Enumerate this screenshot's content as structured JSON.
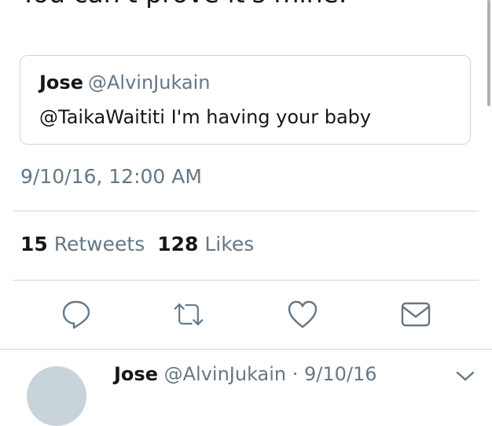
{
  "tweet": {
    "text_partial": "You can't prove it's mine.",
    "timestamp": "9/10/16, 12:00 AM"
  },
  "quoted_tweet": {
    "name": "Jose",
    "handle": "@AlvinJukain",
    "text": "@TaikaWaititi I'm having your baby"
  },
  "stats": {
    "retweets_count": "15",
    "retweets_label": "Retweets",
    "likes_count": "128",
    "likes_label": "Likes"
  },
  "actions": {
    "reply_icon": "reply-icon",
    "retweet_icon": "retweet-icon",
    "like_icon": "heart-icon",
    "share_icon": "mail-icon"
  },
  "reply_preview": {
    "name": "Jose",
    "handle_and_date": "@AlvinJukain · 9/10/16"
  },
  "colors": {
    "text_primary": "#14171a",
    "text_secondary": "#657786",
    "border": "#ccd6dd"
  }
}
